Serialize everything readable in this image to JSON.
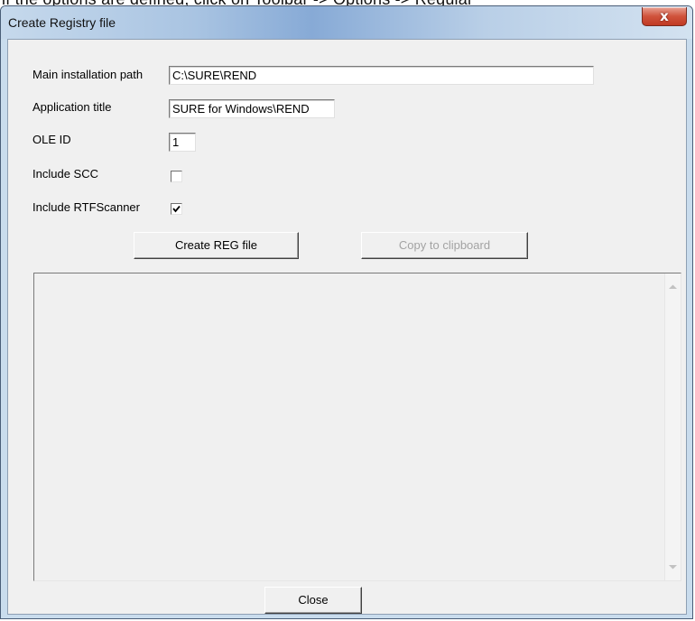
{
  "background_text": "if the options are defined, click on Toolbar -> Options -> Regular",
  "window": {
    "title": "Create Registry file",
    "close_glyph": "x"
  },
  "form": {
    "main_path_label": "Main installation path",
    "main_path_value": "C:\\SURE\\REND",
    "app_title_label": "Application title",
    "app_title_value": "SURE for Windows\\REND",
    "ole_id_label": "OLE ID",
    "ole_id_value": "1",
    "include_scc_label": "Include SCC",
    "include_scc_checked": false,
    "include_rtf_label": "Include RTFScanner",
    "include_rtf_checked": true
  },
  "buttons": {
    "create_reg": "Create REG file",
    "copy_clipboard": "Copy to clipboard",
    "close": "Close"
  },
  "output": {
    "text": ""
  },
  "icons": {
    "close": "close-icon",
    "checkmark": "checkmark-icon",
    "scroll_up": "scroll-up-arrow-icon",
    "scroll_down": "scroll-down-arrow-icon"
  },
  "colors": {
    "client_bg": "#f0f0f0",
    "close_button": "#c9442d",
    "titlebar_accent": "#87aad6"
  }
}
